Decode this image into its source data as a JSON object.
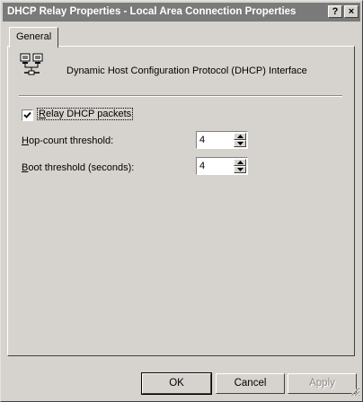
{
  "window": {
    "title": "DHCP Relay Properties - Local Area Connection Properties",
    "help_label": "?",
    "close_label": "×"
  },
  "tabs": [
    {
      "label": "General",
      "selected": true
    }
  ],
  "interface": {
    "icon": "network-connection-icon",
    "name": "Dynamic Host Configuration Protocol (DHCP) Interface"
  },
  "relay": {
    "label_mnemonic": "R",
    "label_rest": "elay DHCP packets",
    "checked": true
  },
  "hop_count": {
    "label_mnemonic": "H",
    "label_rest": "op-count threshold:",
    "value": "4"
  },
  "boot_threshold": {
    "label_mnemonic": "B",
    "label_rest": "oot threshold (seconds):",
    "value": "4"
  },
  "buttons": {
    "ok": "OK",
    "cancel": "Cancel",
    "apply": "Apply"
  }
}
